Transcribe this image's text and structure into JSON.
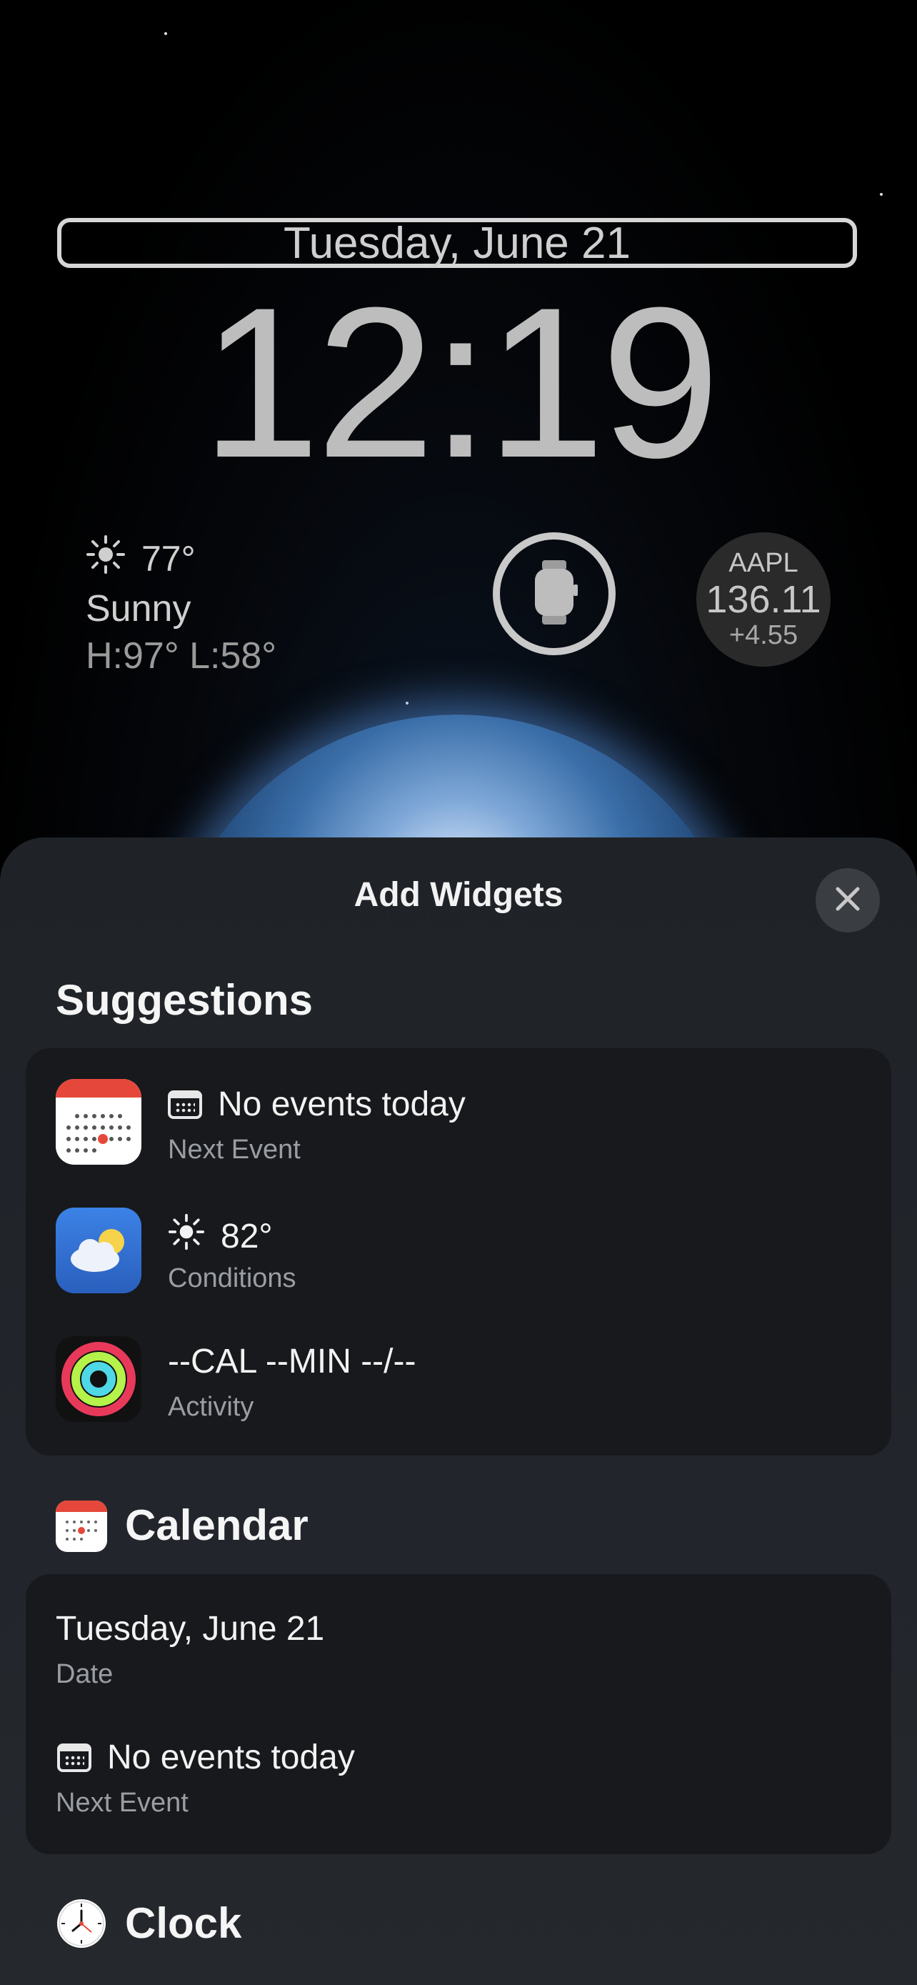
{
  "lockscreen": {
    "date": "Tuesday, June 21",
    "time": "12:19",
    "weather": {
      "temp": "77°",
      "condition": "Sunny",
      "high_low": "H:97° L:58°",
      "icon": "sun-icon"
    },
    "watch_widget": {
      "icon": "apple-watch-icon"
    },
    "stock": {
      "symbol": "AAPL",
      "price": "136.11",
      "change": "+4.55"
    }
  },
  "sheet": {
    "title": "Add Widgets",
    "close_icon": "close-icon",
    "suggestions_heading": "Suggestions",
    "suggestions": [
      {
        "app": "Calendar",
        "icon": "calendar-app-icon",
        "inline_icon": "calendar-icon",
        "title": "No events today",
        "subtitle": "Next Event"
      },
      {
        "app": "Weather",
        "icon": "weather-app-icon",
        "inline_icon": "sun-icon",
        "title": "82°",
        "subtitle": "Conditions"
      },
      {
        "app": "Fitness",
        "icon": "activity-app-icon",
        "title": "--CAL --MIN --/--",
        "subtitle": "Activity"
      }
    ],
    "calendar_heading": "Calendar",
    "calendar_items": [
      {
        "title": "Tuesday, June 21",
        "subtitle": "Date"
      },
      {
        "title": "No events today",
        "subtitle": "Next Event",
        "inline_icon": "calendar-icon"
      }
    ],
    "clock_heading": "Clock"
  },
  "colors": {
    "sheet_bg": "#1f2328",
    "card_bg": "#17191c",
    "calendar_red": "#e5483b"
  }
}
